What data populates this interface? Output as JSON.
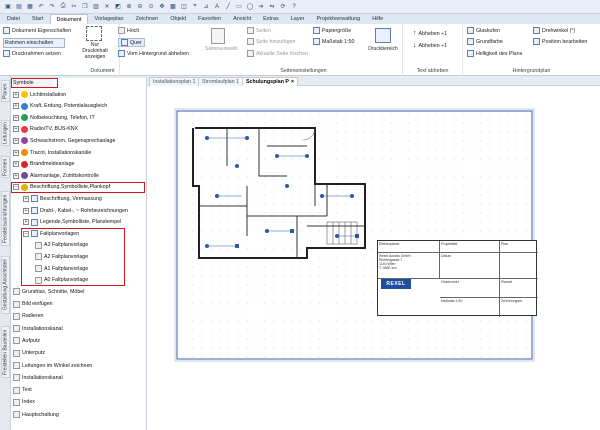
{
  "ribbon_tabs": [
    "Datei",
    "Start",
    "Dokument",
    "Vorlageplan",
    "Zeichnen",
    "Objekt",
    "Favoriten",
    "Ansicht",
    "Extras",
    "Layer",
    "Projektverwaltung",
    "Hilfe"
  ],
  "active_tab": "Dokument",
  "ribbon": {
    "doc": {
      "eigenschaften": "Dokument Eigenschaften",
      "rahmen": "Rahmen einschalten",
      "druckrahmen": "Druckrahmen setzen",
      "nur_druckinhalt": "Nur Druckinhalt anzeigen",
      "hoch": "Hoch",
      "quer": "Quer",
      "vom_hintergrund": "Vom Hintergrund abheben",
      "label": "Dokument"
    },
    "seite": {
      "seitenauswahl": "Seitenauswahl",
      "seiten": "Seiten",
      "hinzufuegen": "Seite hinzufügen",
      "loeschen": "Aktuelle Seite löschen",
      "papiergroesse": "Papiergröße",
      "massstab": "Maßstab 1:50",
      "druckbereich": "Druckbereich",
      "label": "Seiteneinstellungen"
    },
    "text": {
      "abheben1": "Abheben ÷1",
      "abheben2": "Abheben ÷1",
      "label": "Text abheben"
    },
    "hg": {
      "glaskugeln": "Glaskufen",
      "grundfarbe": "Grundfarbe",
      "helligkeit": "Helligkeit des Plans",
      "drehwinkel": "Drehwinkel (°)",
      "position": "Position bearbeiten",
      "label": "Hintergrundplan"
    }
  },
  "doc_tabs": [
    "Installationsplan 1",
    "Stromlaufplan 1",
    "Schulungsplan P"
  ],
  "side_tabs": [
    "Planen",
    "Leitungen",
    "Formen",
    "Fensterausrichtungen",
    "Gestaltung Ansichtsteil",
    "Freistellen Bauteilen"
  ],
  "panel_title": "Symbole",
  "panel_items": [
    "Lichtinstallation",
    "Kraft, Erdung, Potentialausgleich",
    "Notbeleuchtung, Telefon, IT",
    "Radio/TV, BUS-KNX",
    "Schwachstrom, Gegensprechanlage",
    "Tracot, Installationskanäle",
    "Brandmeldeanlage",
    "Alarmanlage, Zutrittskontrolle",
    "Beschriftung,Symbolliste,Plankopf",
    "Beschriftung, Vermassung",
    "Draht-, Kabel-, ~ Rohrbezeichnungen",
    "Legende,Symbolliste, Planstempel",
    "Faltplanvorlagen",
    "A3 Faltplanvorlage",
    "A2 Faltplanvorlage",
    "A1 Faltplanvorlage",
    "A0 Faltplanvorlage",
    "Grundriss, Schnitte, Möbel",
    "Bild einfügen",
    "Radieren",
    "Installationskanal",
    "Aufputz",
    "Unterputz",
    "Leitungen im Winkel zeichnen",
    "Installationskanal",
    "Text",
    "Index",
    "Hauptschaltung"
  ],
  "title_block": {
    "planungsbuero": "Elektroplaner",
    "projekt": "Projekttitel",
    "plan": "Plan",
    "datum": "Datum",
    "brand": "REXEL",
    "addr": "Rexel Austria GmbH\nRichtergasse 7\n1140 Wien\nT: 0680 xxx",
    "gez": "Gezeichnet",
    "massstab": "Maßstab 1:50",
    "planart": "Planart",
    "zeichnungsnr": "Zeichnungsnr."
  },
  "colors": {
    "accent": "#2a5ba8",
    "highlight": "#d0191e"
  }
}
